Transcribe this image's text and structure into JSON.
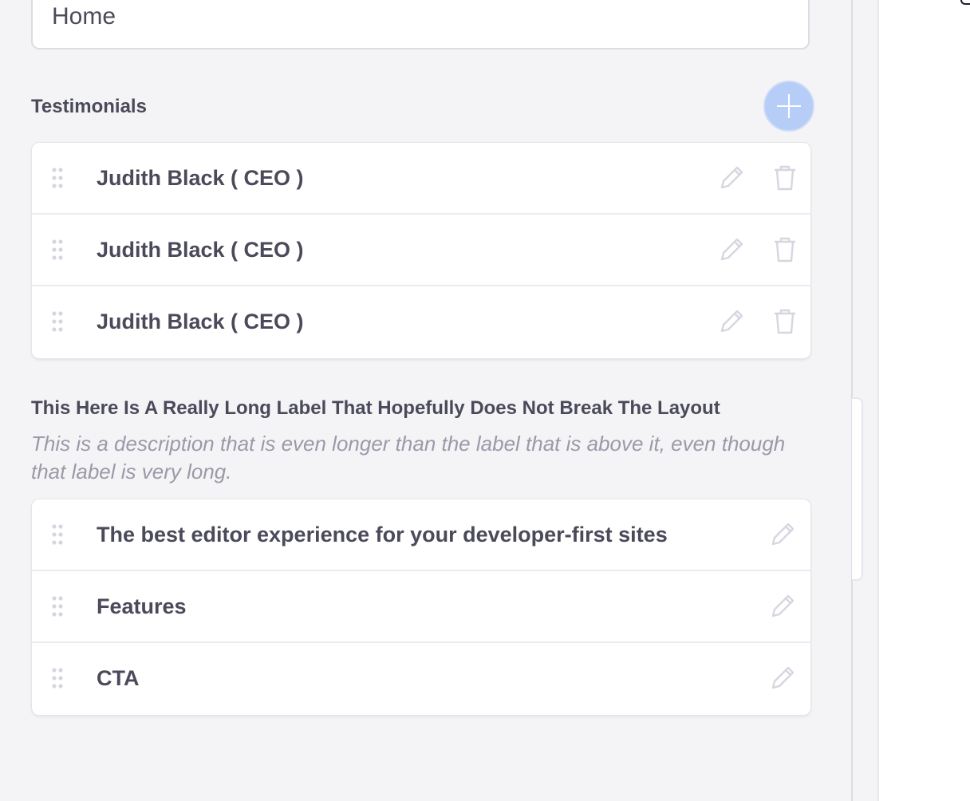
{
  "title_field": {
    "value": "Home"
  },
  "testimonials": {
    "title": "Testimonials",
    "add_button_icon": "plus-icon",
    "items": [
      {
        "label": "Judith Black ( CEO )"
      },
      {
        "label": "Judith Black ( CEO )"
      },
      {
        "label": "Judith Black ( CEO )"
      }
    ]
  },
  "long_section": {
    "title": "This Here Is A Really Long Label That Hopefully Does Not Break The Layout",
    "description": "This is a description that is even longer than the label that is above it, even though that label is very long.",
    "items": [
      {
        "label": "The best editor experience for your developer-first sites"
      },
      {
        "label": "Features"
      },
      {
        "label": "CTA"
      }
    ]
  },
  "colors": {
    "background": "#f4f4f7",
    "accent_button": "#b6cdf7",
    "text": "#4a4a5a",
    "muted_text": "#9a9aa8",
    "icon": "#d6d6e0"
  },
  "icons": {
    "drag": "drag-handle-icon",
    "edit": "pencil-icon",
    "delete": "trash-icon"
  }
}
